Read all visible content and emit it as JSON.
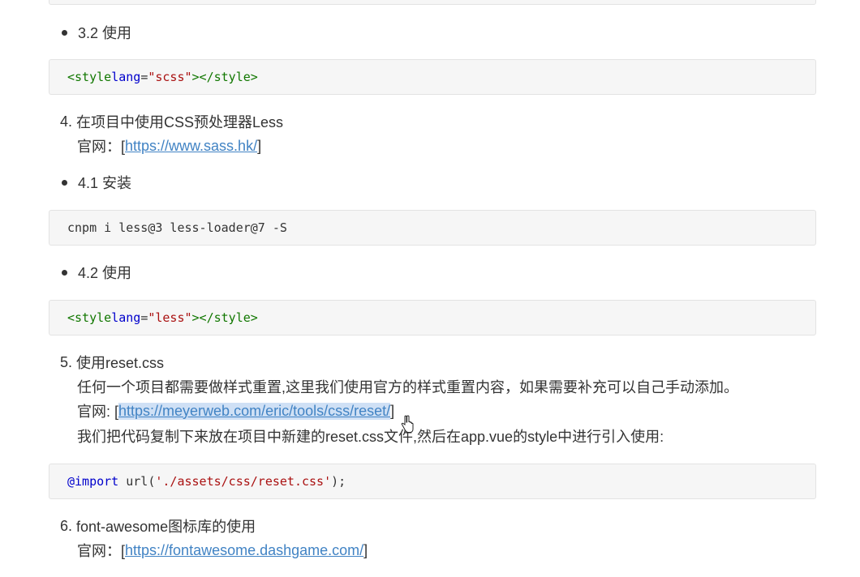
{
  "code_top": "",
  "section_3_2": {
    "label": "3.2 使用"
  },
  "code_3_2": {
    "tag_open": "<style",
    "attr": "lang",
    "eq": "=",
    "value": "\"scss\"",
    "tag_close": "></style>"
  },
  "item_4": {
    "number": "4.",
    "title": "在项目中使用CSS预处理器Less",
    "site_prefix": "官网：[",
    "url": "https://www.sass.hk/",
    "site_suffix": "]"
  },
  "section_4_1": {
    "label": "4.1 安装"
  },
  "code_4_1": {
    "text": "cnpm i less@3 less-loader@7 -S"
  },
  "section_4_2": {
    "label": "4.2 使用"
  },
  "code_4_2": {
    "tag_open": "<style",
    "attr": "lang",
    "eq": "=",
    "value": "\"less\"",
    "tag_close": "></style>"
  },
  "item_5": {
    "number": "5.",
    "title": "使用reset.css",
    "desc": "任何一个项目都需要做样式重置,这里我们使用官方的样式重置内容，如果需要补充可以自己手动添加。",
    "site_prefix": "官网: [",
    "url": "https://meyerweb.com/eric/tools/css/reset/",
    "site_suffix": "]",
    "note": "我们把代码复制下来放在项目中新建的reset.css文件,然后在app.vue的style中进行引入使用:"
  },
  "code_5": {
    "keyword": "@import",
    "func": " url(",
    "value": "'./assets/css/reset.css'",
    "end": ");"
  },
  "item_6": {
    "number": "6.",
    "title": "font-awesome图标库的使用",
    "site_prefix": "官网：[",
    "url": "https://fontawesome.dashgame.com/",
    "site_suffix": "]"
  }
}
